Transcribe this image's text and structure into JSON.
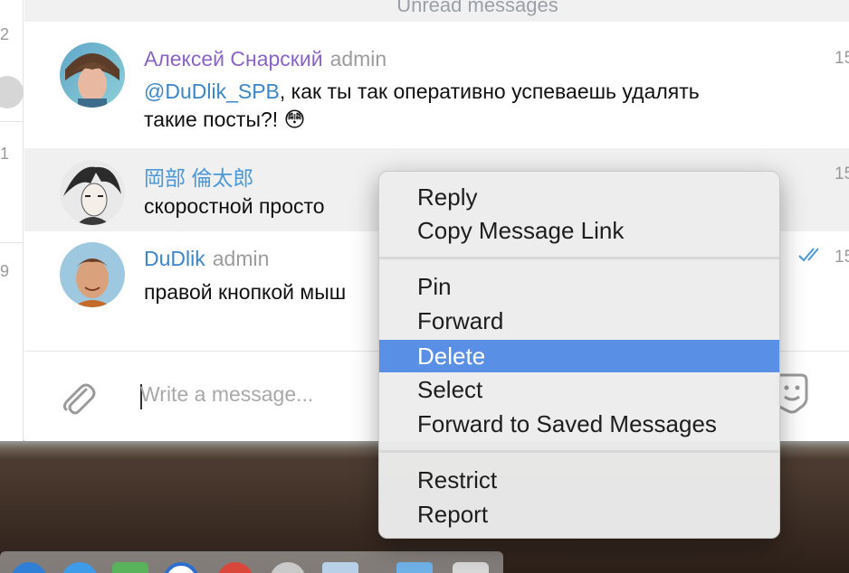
{
  "chat_list": {
    "counts": [
      "2",
      "1",
      "9"
    ]
  },
  "unread_label": "Unread messages",
  "messages": [
    {
      "author": "Алексей Снарский",
      "role": "admin",
      "author_color": "#8a63c7",
      "mention": "@DuDlik_SPB",
      "text_line1": ", как ты так оперативно успеваешь удалять",
      "text_line2": "такие посты?! 😳",
      "time": "15"
    },
    {
      "author": "岡部 倫太郎",
      "role": "",
      "author_color": "#4a98d8",
      "text_line1": "скоростной просто",
      "time": "15"
    },
    {
      "author": "DuDlik",
      "role": "admin",
      "author_color": "#3a86c8",
      "text_line1": "правой кнопкой мыш",
      "time": "15",
      "status_icon": "double-check-icon"
    }
  ],
  "composer": {
    "placeholder": "Write a message..."
  },
  "context_menu": {
    "items": [
      "Reply",
      "Copy Message Link",
      "Pin",
      "Forward",
      "Delete",
      "Select",
      "Forward to Saved Messages",
      "Restrict",
      "Report"
    ],
    "selected": "Delete",
    "accent_color": "#5a8fe6"
  }
}
